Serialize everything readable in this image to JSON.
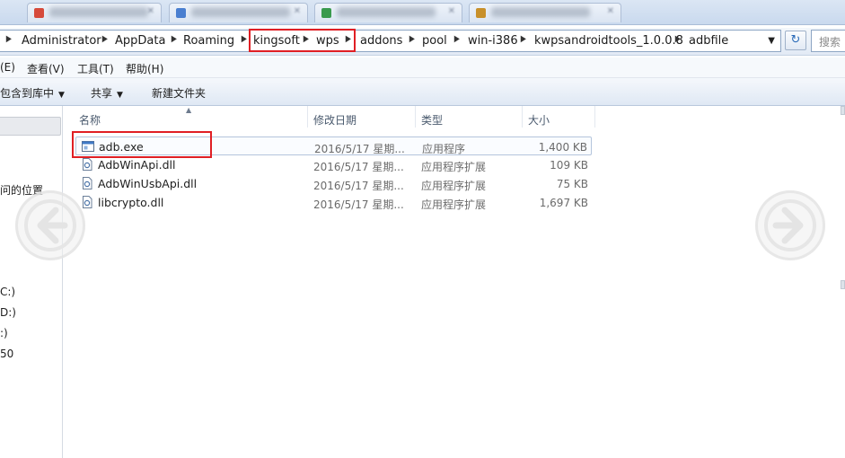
{
  "window": {
    "tabs": [
      {
        "color": "#d64a3b"
      },
      {
        "color": "#4a7fd0"
      },
      {
        "color": "#3a9a4d"
      },
      {
        "color": "#c8902a"
      }
    ]
  },
  "address": {
    "breadcrumbs": [
      "Administrator",
      "AppData",
      "Roaming",
      "kingsoft",
      "wps",
      "addons",
      "pool",
      "win-i386",
      "kwpsandroidtools_1.0.0.8",
      "adbfile"
    ],
    "dropdown_icon": "chevron-down-icon",
    "refresh_icon": "refresh-icon",
    "search_placeholder": "搜索"
  },
  "menubar": {
    "items": [
      "(E)",
      "查看(V)",
      "工具(T)",
      "帮助(H)"
    ]
  },
  "toolbar": {
    "include_in_library": "包含到库中",
    "share": "共享",
    "new_folder": "新建文件夹"
  },
  "navpane": {
    "recent_places": "问的位置",
    "drives": [
      "C:)",
      "D:)",
      ":)",
      "50"
    ]
  },
  "filelist": {
    "columns": {
      "name": "名称",
      "modified": "修改日期",
      "type": "类型",
      "size": "大小"
    },
    "files": [
      {
        "name": "adb.exe",
        "modified": "2016/5/17 星期...",
        "type": "应用程序",
        "size": "1,400 KB",
        "icon": "exe-icon"
      },
      {
        "name": "AdbWinApi.dll",
        "modified": "2016/5/17 星期...",
        "type": "应用程序扩展",
        "size": "109 KB",
        "icon": "dll-icon"
      },
      {
        "name": "AdbWinUsbApi.dll",
        "modified": "2016/5/17 星期...",
        "type": "应用程序扩展",
        "size": "75 KB",
        "icon": "dll-icon"
      },
      {
        "name": "libcrypto.dll",
        "modified": "2016/5/17 星期...",
        "type": "应用程序扩展",
        "size": "1,697 KB",
        "icon": "dll-icon"
      }
    ]
  },
  "annotations": {
    "highlight_color": "#e01f24"
  }
}
